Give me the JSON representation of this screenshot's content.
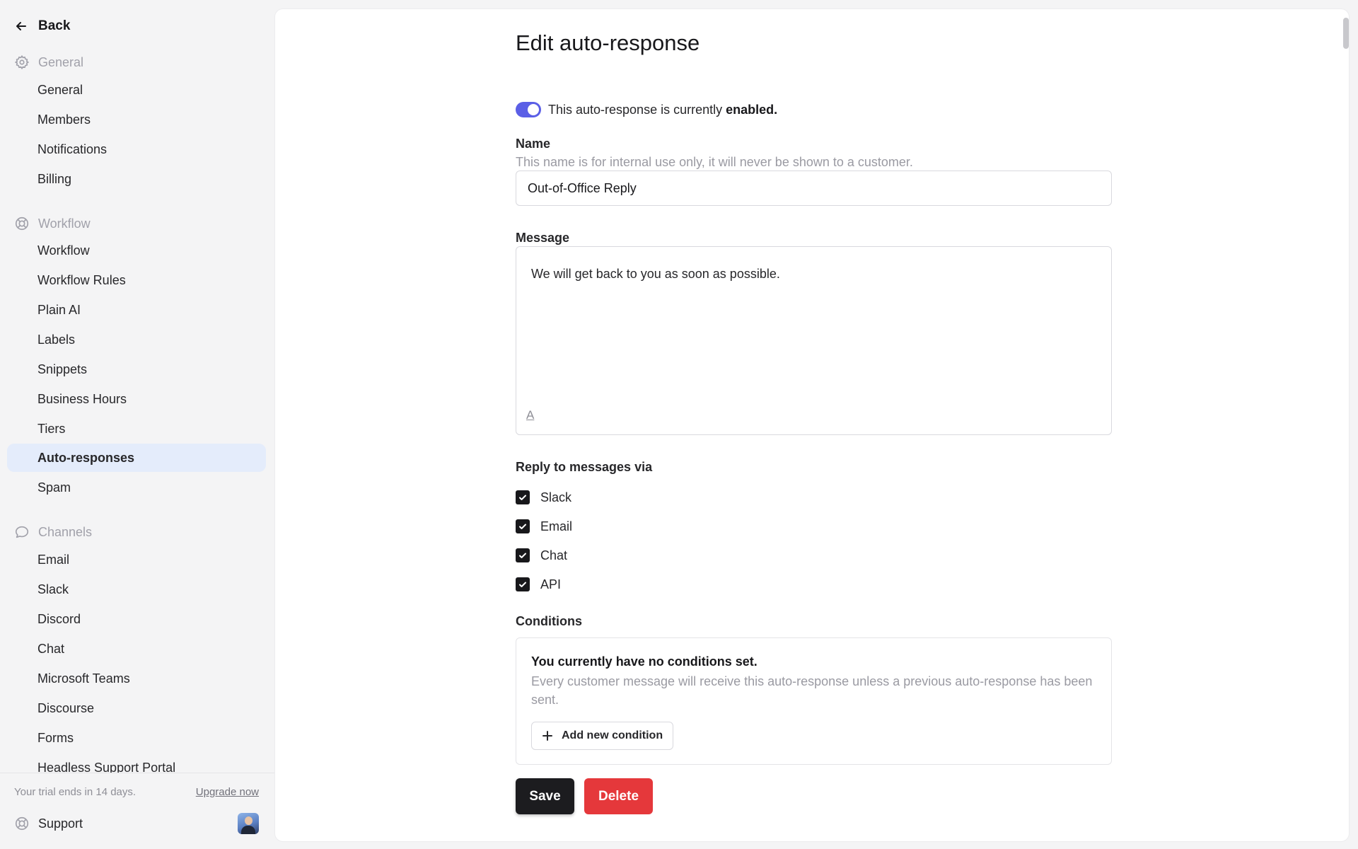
{
  "sidebar": {
    "back_label": "Back",
    "sections": [
      {
        "title": "General",
        "icon": "gear-icon",
        "items": [
          "General",
          "Members",
          "Notifications",
          "Billing"
        ]
      },
      {
        "title": "Workflow",
        "icon": "lifebuoy-icon",
        "items": [
          "Workflow",
          "Workflow Rules",
          "Plain AI",
          "Labels",
          "Snippets",
          "Business Hours",
          "Tiers",
          "Auto-responses",
          "Spam"
        ]
      },
      {
        "title": "Channels",
        "icon": "chat-bubble-icon",
        "items": [
          "Email",
          "Slack",
          "Discord",
          "Chat",
          "Microsoft Teams",
          "Discourse",
          "Forms",
          "Headless Support Portal"
        ]
      }
    ],
    "active_item": "Auto-responses",
    "footer": {
      "trial_text": "Your trial ends in 14 days.",
      "upgrade_label": "Upgrade now",
      "support_label": "Support"
    }
  },
  "main": {
    "title": "Edit auto-response",
    "toggle": {
      "enabled": true,
      "text_prefix": "This auto-response is currently",
      "status_word": "enabled."
    },
    "name_field": {
      "label": "Name",
      "hint": "This name is for internal use only, it will never be shown to a customer.",
      "value": "Out-of-Office Reply"
    },
    "message_field": {
      "label": "Message",
      "value": "We will get back to you as soon as possible.",
      "format_icon_glyph": "A"
    },
    "reply_via": {
      "label": "Reply to messages via",
      "options": [
        {
          "label": "Slack",
          "checked": true
        },
        {
          "label": "Email",
          "checked": true
        },
        {
          "label": "Chat",
          "checked": true
        },
        {
          "label": "API",
          "checked": true
        }
      ]
    },
    "conditions": {
      "label": "Conditions",
      "empty_title": "You currently have no conditions set.",
      "empty_desc": "Every customer message will receive this auto-response unless a previous auto-response has been sent.",
      "add_label": "Add new condition"
    },
    "actions": {
      "save_label": "Save",
      "delete_label": "Delete"
    }
  },
  "colors": {
    "accent": "#5b5fe6",
    "active_nav_bg": "#e4ecfb",
    "danger": "#e5383b",
    "primary_button": "#1c1c1f"
  }
}
